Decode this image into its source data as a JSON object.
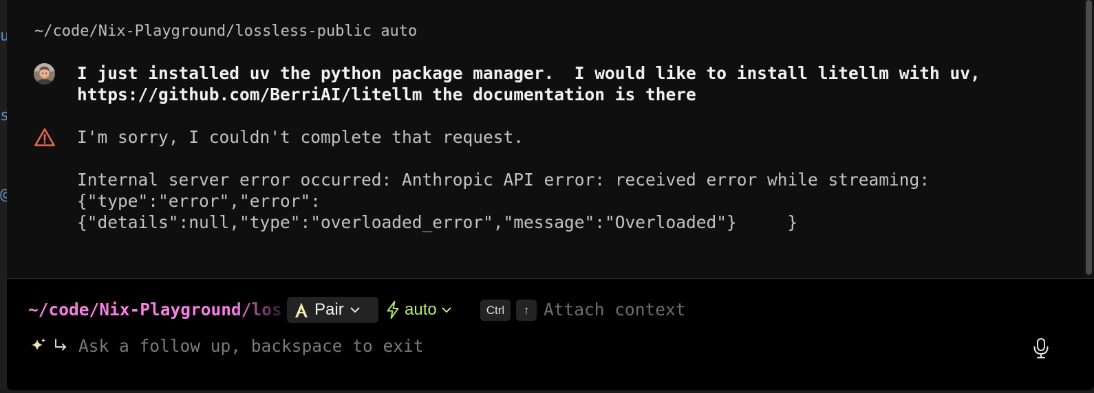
{
  "background_editor": {
    "visible_glyphs": [
      "u",
      "s",
      "@"
    ]
  },
  "conversation": {
    "cwd_line": "~/code/Nix-Playground/lossless-public auto",
    "user_message": {
      "line1": "I just installed uv the python package manager.  I would like to install litellm with uv,",
      "line2": "https://github.com/BerriAI/litellm the documentation is there"
    },
    "error_message": {
      "summary": "I'm sorry, I couldn't complete that request.",
      "detail_line1": "Internal server error occurred: Anthropic API error: received error while streaming:",
      "detail_line2": "{\"type\":\"error\",\"error\":",
      "detail_line3": "{\"details\":null,\"type\":\"overloaded_error\",\"message\":\"Overloaded\"}     }"
    }
  },
  "input_bar": {
    "path": "~/code/Nix-Playground/lossless-public",
    "mode_label": "Pair",
    "model_label": "auto",
    "shortcut_keys": [
      "Ctrl",
      "↑"
    ],
    "attach_label": "Attach context",
    "placeholder": "Ask a follow up, backspace to exit"
  },
  "icons": {
    "user": "avatar",
    "error": "warning-triangle-icon",
    "mode": "pair-agent-icon",
    "model": "lightning-bolt-icon",
    "dropdown": "chevron-down-icon",
    "ai_hint": "sparkle-icon",
    "follow_up": "return-arrow-icon",
    "voice": "microphone-icon"
  },
  "colors": {
    "path_pink": "#f77fe3",
    "auto_green": "#b9e86f",
    "warning_red": "#e26a50",
    "panel_bg": "#0f0f0f",
    "input_bg": "#000000"
  }
}
